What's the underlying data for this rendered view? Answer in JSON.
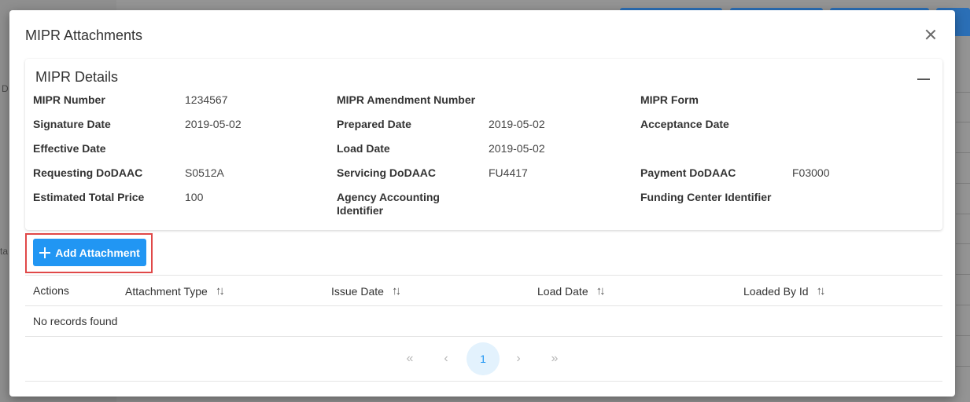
{
  "dialog": {
    "title": "MIPR Attachments"
  },
  "details": {
    "title": "MIPR Details",
    "fields": {
      "mipr_number": {
        "label": "MIPR Number",
        "value": "1234567"
      },
      "amendment_number": {
        "label": "MIPR Amendment Number",
        "value": ""
      },
      "mipr_form": {
        "label": "MIPR Form",
        "value": ""
      },
      "signature_date": {
        "label": "Signature Date",
        "value": "2019-05-02"
      },
      "prepared_date": {
        "label": "Prepared Date",
        "value": "2019-05-02"
      },
      "acceptance_date": {
        "label": "Acceptance Date",
        "value": ""
      },
      "effective_date": {
        "label": "Effective Date",
        "value": ""
      },
      "load_date": {
        "label": "Load Date",
        "value": "2019-05-02"
      },
      "requesting_dodaac": {
        "label": "Requesting DoDAAC",
        "value": "S0512A"
      },
      "servicing_dodaac": {
        "label": "Servicing DoDAAC",
        "value": "FU4417"
      },
      "payment_dodaac": {
        "label": "Payment DoDAAC",
        "value": "F03000"
      },
      "estimated_total_price": {
        "label": "Estimated Total Price",
        "value": "100"
      },
      "agency_accounting_id": {
        "label_line1": "Agency Accounting",
        "label_line2": "Identifier",
        "value": ""
      },
      "funding_center_id": {
        "label": "Funding Center Identifier",
        "value": ""
      }
    }
  },
  "add_attachment": {
    "label": "Add Attachment",
    "icon": "plus-icon"
  },
  "table": {
    "columns": [
      "Actions",
      "Attachment Type",
      "Issue Date",
      "Load Date",
      "Loaded By Id"
    ],
    "empty_message": "No records found"
  },
  "paginator": {
    "current_page": "1",
    "first_glyph": "«",
    "prev_glyph": "‹",
    "next_glyph": "›",
    "last_glyph": "»"
  },
  "background": {
    "left_char_1": "D",
    "left_char_2": "ta"
  },
  "colors": {
    "primary": "#2196f3",
    "highlight_border": "#e04848"
  }
}
